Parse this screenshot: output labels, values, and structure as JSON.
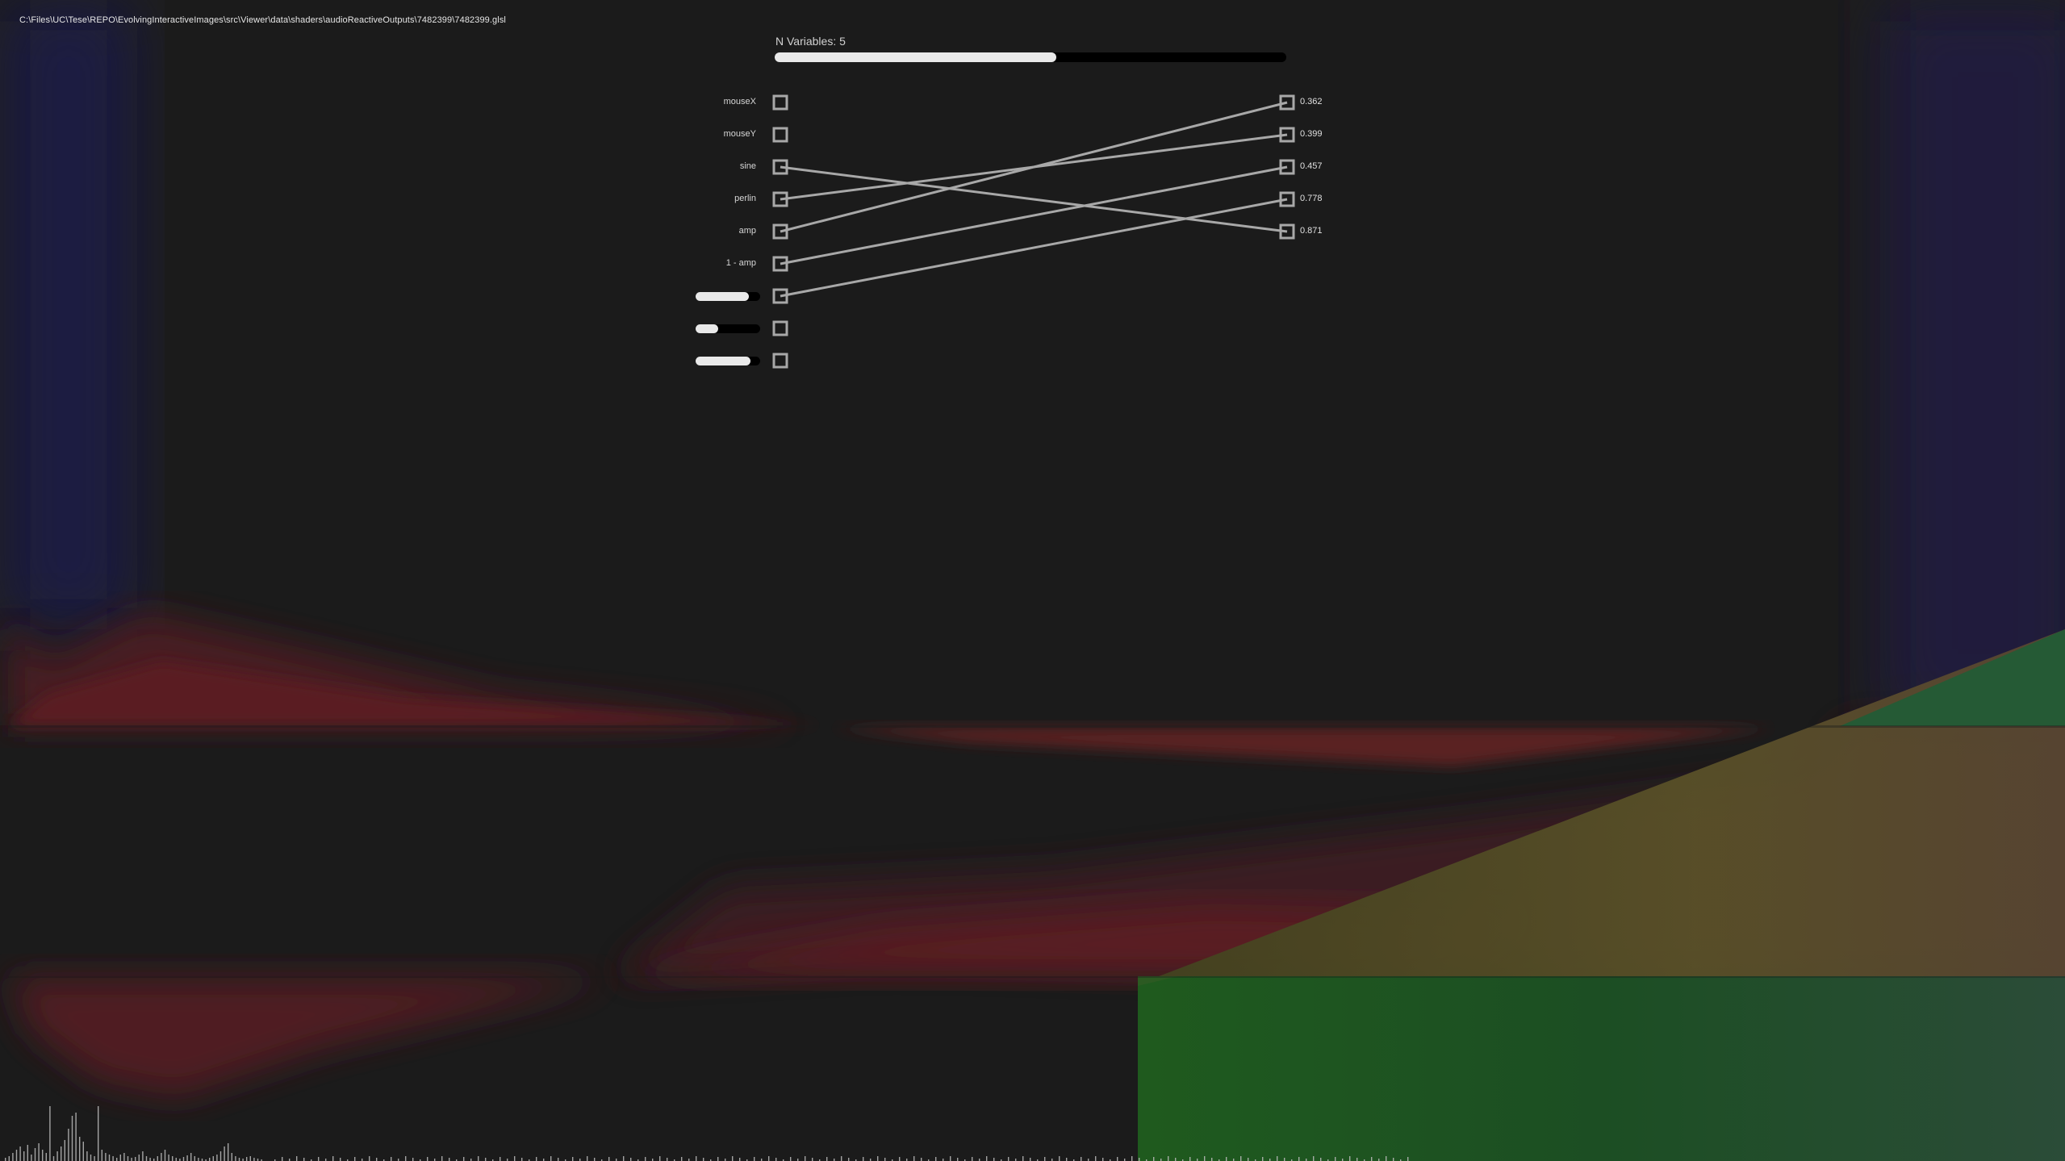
{
  "file_path": "C:\\Files\\UC\\Tese\\REPO\\EvolvingInteractiveImages\\src\\Viewer\\data\\shaders\\audioReactiveOutputs\\7482399\\7482399.glsl",
  "variables_slider": {
    "label": "N Variables: 5",
    "fraction": 0.55
  },
  "inputs": [
    {
      "label": "mouseX"
    },
    {
      "label": "mouseY"
    },
    {
      "label": "sine"
    },
    {
      "label": "perlin"
    },
    {
      "label": "amp"
    },
    {
      "label": "1 - amp"
    },
    {
      "slider": 0.82
    },
    {
      "slider": 0.35
    },
    {
      "slider": 0.85
    }
  ],
  "outputs": [
    {
      "value": "0.362"
    },
    {
      "value": "0.399"
    },
    {
      "value": "0.457"
    },
    {
      "value": "0.778"
    },
    {
      "value": "0.871"
    }
  ],
  "connections": [
    {
      "input": 2,
      "output": 4
    },
    {
      "input": 3,
      "output": 1
    },
    {
      "input": 4,
      "output": 0
    },
    {
      "input": 5,
      "output": 2
    },
    {
      "input": 6,
      "output": 3
    }
  ],
  "colors": {
    "node_border": "#a8a8a8",
    "connection_line": "#a8a8a8",
    "slider_fill": "#e9e9e9",
    "slider_track": "#000000"
  }
}
